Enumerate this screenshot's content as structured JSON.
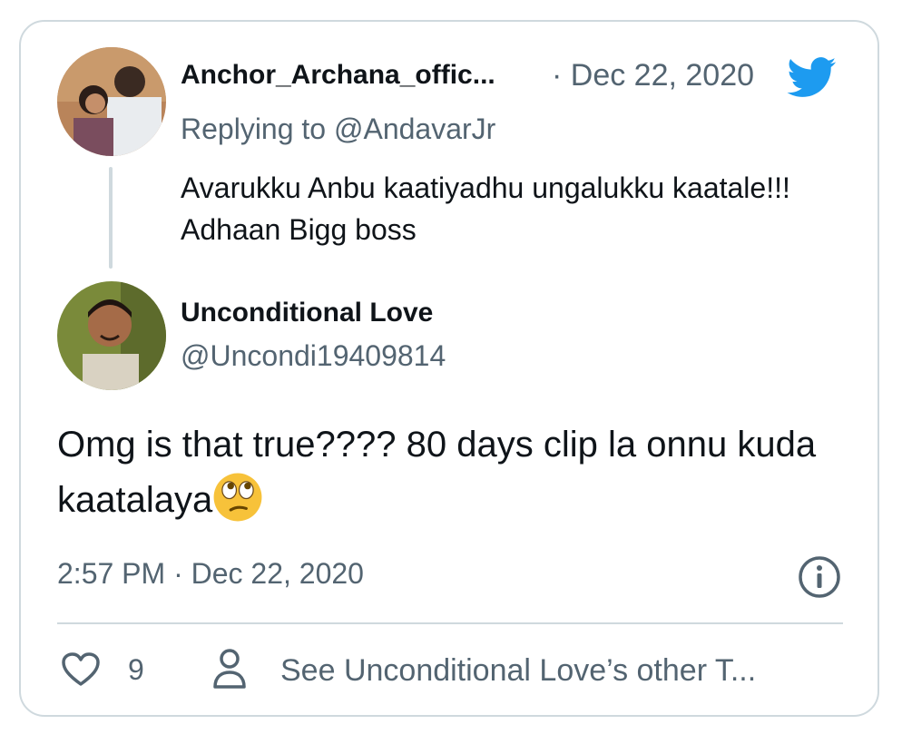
{
  "quoted_tweet": {
    "author_name": "Anchor_Archana_offic...",
    "date_sep": "· Dec 22, 2020",
    "replying_prefix": "Replying to ",
    "replying_handle": "@AndavarJr",
    "text": "Avarukku Anbu kaatiyadhu ungalukku kaatale!!! Adhaan Bigg boss"
  },
  "tweet": {
    "author_name": "Unconditional Love",
    "handle": "@Uncondi19409814",
    "text": "Omg is that true???? 80 days clip la onnu kuda kaatalaya",
    "emoji": "face-with-rolling-eyes",
    "timestamp": "2:57 PM · Dec 22, 2020"
  },
  "actions": {
    "like_count": "9",
    "see_other_label": "See Unconditional Love’s other T..."
  },
  "colors": {
    "brand": "#1d9bf0",
    "muted": "#536471",
    "border": "#cfd9de",
    "text": "#0f1419"
  },
  "icons": {
    "brand": "twitter-bird-icon",
    "info": "info-icon",
    "like": "heart-icon",
    "profile": "person-icon"
  }
}
